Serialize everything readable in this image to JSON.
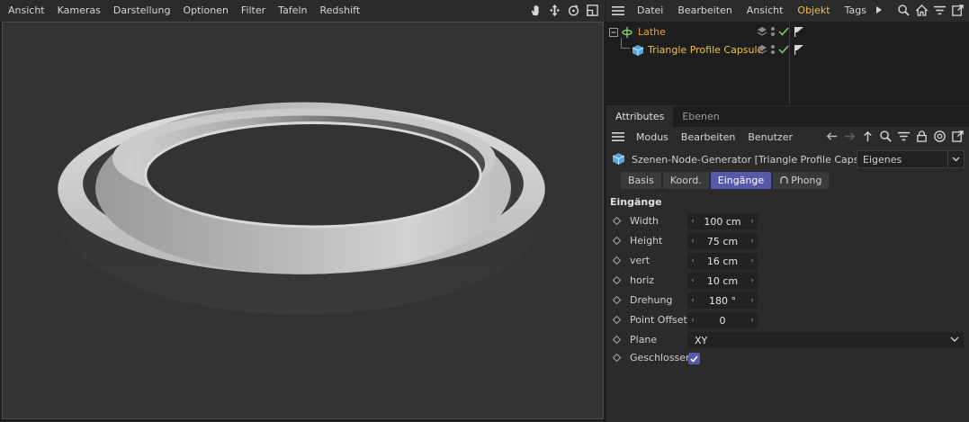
{
  "viewport": {
    "menu": [
      "Ansicht",
      "Kameras",
      "Darstellung",
      "Optionen",
      "Filter",
      "Tafeln",
      "Redshift"
    ],
    "nav_icons": [
      "hand-pan-icon",
      "move-arrows-icon",
      "rotate-icon",
      "maximize-icon"
    ]
  },
  "object_manager": {
    "menu": [
      "Datei",
      "Bearbeiten",
      "Ansicht",
      "Objekt",
      "Tags"
    ],
    "active_menu": "Objekt",
    "objects": [
      {
        "name": "Lathe",
        "level": 0,
        "color": "#e8a43c"
      },
      {
        "name": "Triangle Profile Capsule",
        "level": 1,
        "color": "#f0c14b"
      }
    ]
  },
  "attributes": {
    "tabs": [
      "Attributes",
      "Ebenen"
    ],
    "active_tab": "Attributes",
    "toolbar_menu": [
      "Modus",
      "Bearbeiten",
      "Benutzer"
    ],
    "generator_title": "Szenen-Node-Generator [Triangle Profile Capsule]",
    "generator_mode": "Eigenes",
    "sub_tabs": [
      "Basis",
      "Koord.",
      "Eingänge",
      "Phong"
    ],
    "active_sub_tab": "Eingänge",
    "section": "Eingänge",
    "params": [
      {
        "label": "Width",
        "value": "100 cm"
      },
      {
        "label": "Height",
        "value": "75 cm"
      },
      {
        "label": "vert",
        "value": "16 cm"
      },
      {
        "label": "horiz",
        "value": "10 cm"
      },
      {
        "label": "Drehung",
        "value": "180 °"
      },
      {
        "label": "Point Offset",
        "value": "0"
      }
    ],
    "plane": {
      "label": "Plane",
      "value": "XY"
    },
    "closed": {
      "label": "Geschlossen",
      "checked": true
    }
  },
  "colors": {
    "accent": "#5659a9",
    "object_orange": "#e8a43c",
    "object_yellow": "#f0c14b",
    "check_green": "#7fd36a"
  }
}
